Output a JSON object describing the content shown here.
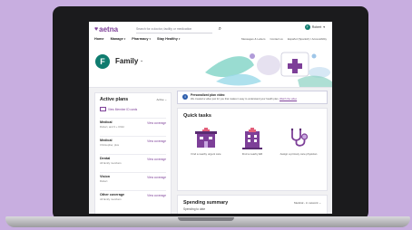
{
  "brand": {
    "name": "aetna"
  },
  "search": {
    "placeholder": "Search for a doctor, facility or medication"
  },
  "user": {
    "initial": "F",
    "name": "Robert",
    "chevron": "▾"
  },
  "nav": {
    "items": [
      {
        "label": "Home"
      },
      {
        "label": "Manage",
        "chevron": "▾"
      },
      {
        "label": "Pharmacy",
        "chevron": "▾"
      },
      {
        "label": "Stay Healthy",
        "chevron": "▾"
      }
    ],
    "right": [
      "Messages & Letters",
      "Contact us",
      "Español (Spanish) / Accessibility"
    ]
  },
  "hero": {
    "avatar_initial": "F",
    "title": "Family",
    "chevron": "⌄"
  },
  "active_plans": {
    "title": "Active plans",
    "filter": "Active ⌄",
    "id_cards_link": "View Member ID cards",
    "plans": [
      {
        "name": "Medical",
        "sub": "Robert, and 3 + Child",
        "link": "View coverage"
      },
      {
        "name": "Medical",
        "sub": "Christopher, plus",
        "link": "View coverage"
      },
      {
        "name": "Dental",
        "sub": "All family members",
        "link": "View coverage"
      },
      {
        "name": "Vision",
        "sub": "Robert",
        "link": "View coverage"
      },
      {
        "name": "Other coverage",
        "sub": "All family members",
        "link": "View coverage"
      }
    ]
  },
  "banner": {
    "icon": "i",
    "title": "Personalized plan video",
    "text": "We created a video just for you that makes it easy to understand your health plan.",
    "link": "Watch the video"
  },
  "quick_tasks": {
    "title": "Quick tasks",
    "tasks": [
      {
        "label": "Find a nearby urgent care",
        "icon": "urgent-care-building-icon"
      },
      {
        "label": "Find a nearby ER",
        "icon": "hospital-icon"
      },
      {
        "label": "Assign a primary care physician",
        "icon": "stethoscope-icon"
      }
    ]
  },
  "spending": {
    "title": "Spending summary",
    "subtitle": "Spending to date",
    "filter": "Medical - in network ⌄"
  },
  "colors": {
    "brand": "#7d3f98",
    "avatar": "#0f7c6f",
    "info": "#2b5cab",
    "desktop": "#c8aee0"
  }
}
